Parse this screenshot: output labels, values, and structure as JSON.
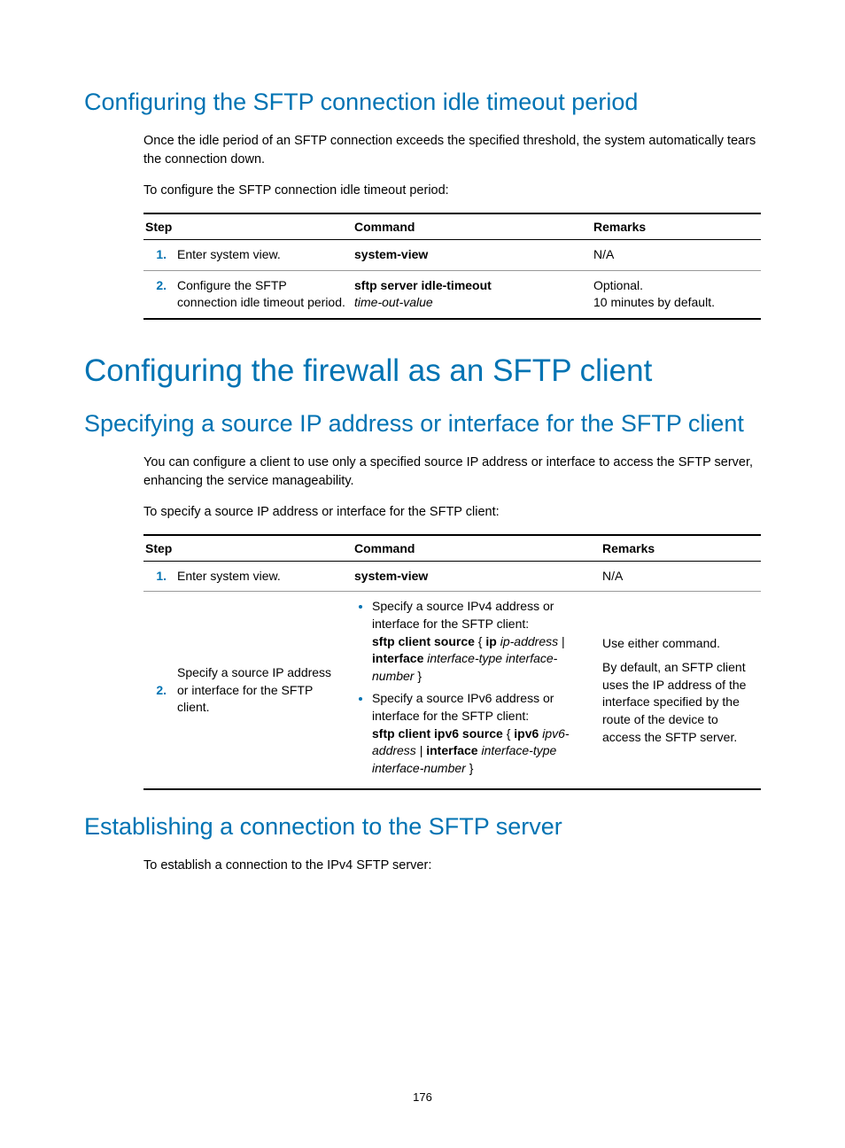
{
  "page_number": "176",
  "s1": {
    "heading": "Configuring the SFTP connection idle timeout period",
    "p1": "Once the idle period of an SFTP connection exceeds the specified threshold, the system automatically tears the connection down.",
    "p2": "To configure the SFTP connection idle timeout period:",
    "table": {
      "h_step": "Step",
      "h_cmd": "Command",
      "h_rmk": "Remarks",
      "r1": {
        "num": "1.",
        "desc": "Enter system view.",
        "cmd": "system-view",
        "rmk": "N/A"
      },
      "r2": {
        "num": "2.",
        "desc": "Configure the SFTP connection idle timeout period.",
        "cmd_bold": "sftp server idle-timeout",
        "cmd_ital": "time-out-value",
        "rmk1": "Optional.",
        "rmk2": "10 minutes by default."
      }
    }
  },
  "s2": {
    "heading": "Configuring the firewall as an SFTP client"
  },
  "s3": {
    "heading": "Specifying a source IP address or interface for the SFTP client",
    "p1": "You can configure a client to use only a specified source IP address or interface to access the SFTP server, enhancing the service manageability.",
    "p2": "To specify a source IP address or interface for the SFTP client:",
    "table": {
      "h_step": "Step",
      "h_cmd": "Command",
      "h_rmk": "Remarks",
      "r1": {
        "num": "1.",
        "desc": "Enter system view.",
        "cmd": "system-view",
        "rmk": "N/A"
      },
      "r2": {
        "num": "2.",
        "desc": "Specify a source IP address or interface for the SFTP client.",
        "b1_intro": "Specify a source IPv4 address or interface for the SFTP client:",
        "b1_cmd_1": "sftp client source",
        "b1_cmd_2": " { ",
        "b1_cmd_3": "ip",
        "b1_cmd_4": " ip-address",
        "b1_cmd_5": " | ",
        "b1_cmd_6": "interface",
        "b1_cmd_7": " interface-type interface-number",
        "b1_cmd_8": " }",
        "b2_intro": "Specify a source IPv6 address or interface for the SFTP client:",
        "b2_cmd_1": "sftp client ipv6 source",
        "b2_cmd_2": " { ",
        "b2_cmd_3": "ipv6",
        "b2_cmd_4": " ipv6-address",
        "b2_cmd_5": " | ",
        "b2_cmd_6": "interface",
        "b2_cmd_7": " interface-type interface-number",
        "b2_cmd_8": " }",
        "rmk1": "Use either command.",
        "rmk2": "By default, an SFTP client uses the IP address of the interface specified by the route of the device to access the SFTP server."
      }
    }
  },
  "s4": {
    "heading": "Establishing a connection to the SFTP server",
    "p1": "To establish a connection to the IPv4 SFTP server:"
  }
}
